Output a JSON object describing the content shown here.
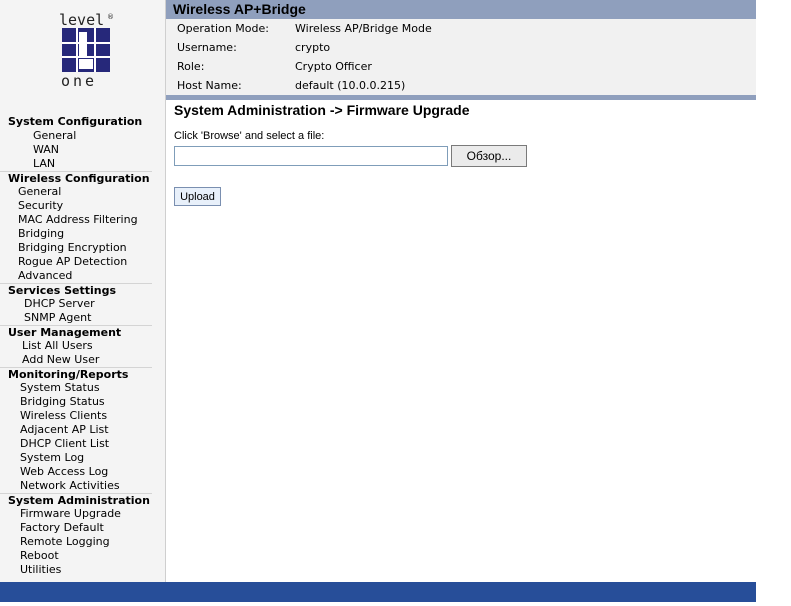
{
  "logo": {
    "top_text": "level",
    "bottom_text": "one",
    "mark": "®"
  },
  "header": {
    "title": "Wireless AP+Bridge",
    "info": [
      {
        "key": "Operation Mode:",
        "value": "Wireless AP/Bridge Mode"
      },
      {
        "key": "Username:",
        "value": "crypto"
      },
      {
        "key": "Role:",
        "value": "Crypto Officer"
      },
      {
        "key": "Host Name:",
        "value": "default (10.0.0.215)"
      }
    ]
  },
  "sidebar": {
    "system_configuration": {
      "title": "System Configuration",
      "items": [
        "General",
        "WAN",
        "LAN"
      ]
    },
    "wireless_configuration": {
      "title": "Wireless Configuration",
      "items": [
        "General",
        "Security",
        "MAC Address Filtering",
        "Bridging",
        "Bridging Encryption",
        "Rogue AP Detection",
        "Advanced"
      ]
    },
    "services_settings": {
      "title": "Services Settings",
      "items": [
        "DHCP Server",
        "SNMP Agent"
      ]
    },
    "user_management": {
      "title": "User Management",
      "items": [
        "List All Users",
        "Add New User"
      ]
    },
    "monitoring_reports": {
      "title": "Monitoring/Reports",
      "items": [
        "System Status",
        "Bridging Status",
        "Wireless Clients",
        "Adjacent AP List",
        "DHCP Client List",
        "System Log",
        "Web Access Log",
        "Network Activities"
      ]
    },
    "system_administration": {
      "title": "System Administration",
      "items": [
        "Firmware Upgrade",
        "Factory Default",
        "Remote Logging",
        "Reboot",
        "Utilities"
      ]
    }
  },
  "main": {
    "heading": "System Administration -> Firmware Upgrade",
    "prompt": "Click 'Browse' and select a file:",
    "file_value": "",
    "browse_label": "Обзор...",
    "upload_label": "Upload"
  },
  "colors": {
    "header_bar": "#8f9fbd",
    "info_bg": "#f1f1f1",
    "footer_bar": "#274e99",
    "logo_blue": "#26287a"
  }
}
